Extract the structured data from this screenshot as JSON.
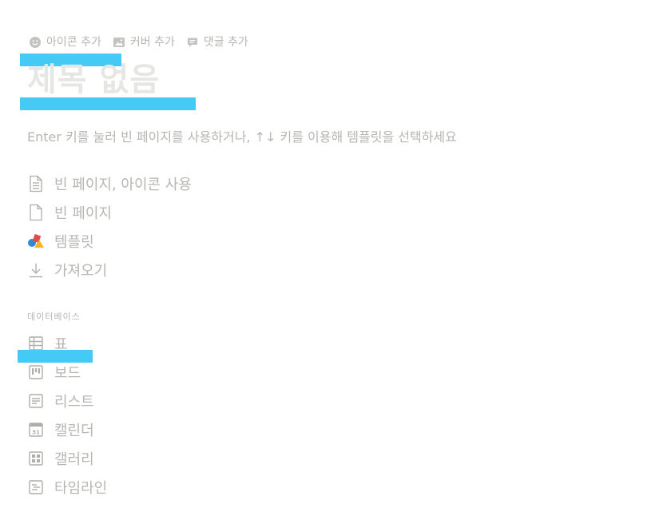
{
  "meta_actions": {
    "add_icon": "아이콘 추가",
    "add_cover": "커버 추가",
    "add_comment": "댓글 추가"
  },
  "title": "제목 없음",
  "hint": "Enter 키를 눌러 빈 페이지를 사용하거나, ↑↓ 키를 이용해 템플릿을 선택하세요",
  "page_options": [
    {
      "label": "빈 페이지, 아이콘 사용",
      "icon": "document-lines-icon"
    },
    {
      "label": "빈 페이지",
      "icon": "document-icon"
    },
    {
      "label": "템플릿",
      "icon": "template-shapes-icon"
    },
    {
      "label": "가져오기",
      "icon": "download-icon"
    }
  ],
  "database_section": {
    "label": "데이터베이스",
    "items": [
      {
        "label": "표",
        "icon": "table-icon"
      },
      {
        "label": "보드",
        "icon": "board-icon"
      },
      {
        "label": "리스트",
        "icon": "list-icon"
      },
      {
        "label": "캘린더",
        "icon": "calendar-icon",
        "calendar_day": "31"
      },
      {
        "label": "갤러리",
        "icon": "gallery-icon"
      },
      {
        "label": "타임라인",
        "icon": "timeline-icon"
      }
    ]
  },
  "colors": {
    "highlight": "#45c9f5",
    "muted_text": "#b7b6b2",
    "title_placeholder": "#e6e6e4"
  }
}
